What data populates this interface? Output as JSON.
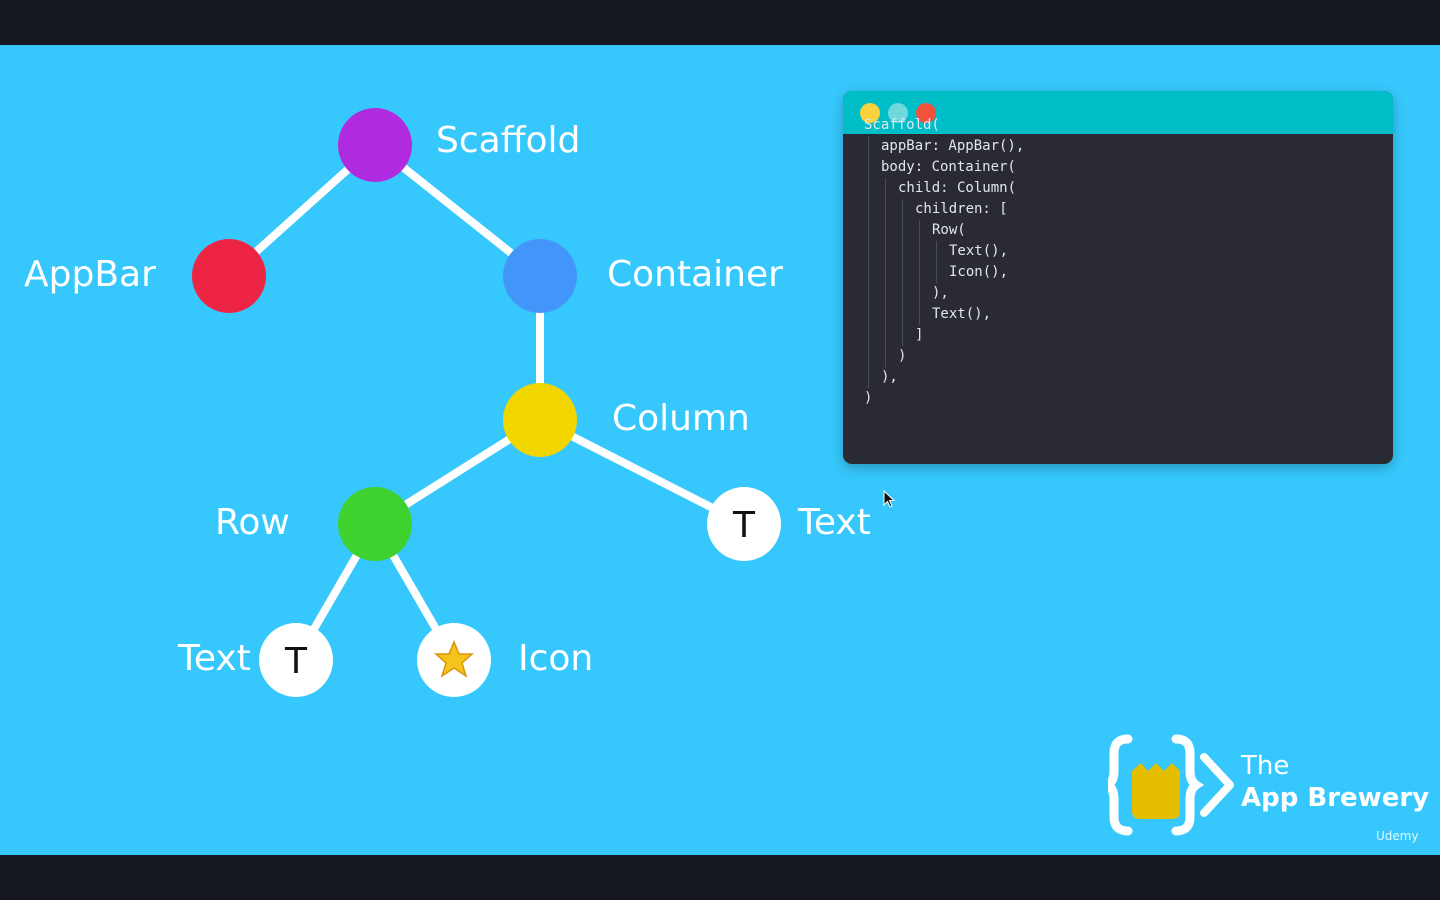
{
  "colors": {
    "background": "#36C8FC",
    "letterbox": "#161821",
    "scaffold": "#B02BDF",
    "appbar": "#EE2444",
    "container": "#4296FA",
    "column": "#F2D600",
    "row": "#3FD22F",
    "leaf": "#FFFFFF",
    "editor_bg": "#292A33",
    "editor_titlebar": "#00BEC8"
  },
  "tree": {
    "scaffold_label": "Scaffold",
    "appbar_label": "AppBar",
    "container_label": "Container",
    "column_label": "Column",
    "row_label": "Row",
    "text_right_label": "Text",
    "text_right_glyph": "T",
    "text_left_label": "Text",
    "text_left_glyph": "T",
    "icon_label": "Icon",
    "icon_glyph": "⭐"
  },
  "code_window": {
    "dots": [
      "yellow-dot",
      "teal-dot",
      "red-dot"
    ],
    "dot_colors": [
      "#F9D23D",
      "#6ED8DD",
      "#F0523B"
    ],
    "lines": [
      {
        "indent": 0,
        "text": "Scaffold("
      },
      {
        "indent": 1,
        "text": "appBar: AppBar(),"
      },
      {
        "indent": 1,
        "text": "body: Container("
      },
      {
        "indent": 2,
        "text": "child: Column("
      },
      {
        "indent": 3,
        "text": "children: ["
      },
      {
        "indent": 4,
        "text": "Row("
      },
      {
        "indent": 5,
        "text": "Text(),"
      },
      {
        "indent": 5,
        "text": "Icon(),"
      },
      {
        "indent": 4,
        "text": "),"
      },
      {
        "indent": 4,
        "text": "Text(),"
      },
      {
        "indent": 3,
        "text": "]"
      },
      {
        "indent": 2,
        "text": ")"
      },
      {
        "indent": 1,
        "text": "),"
      },
      {
        "indent": 0,
        "text": ")"
      }
    ]
  },
  "logo": {
    "line1": "The",
    "line2": "App Brewery",
    "udemy": "Udemy"
  }
}
